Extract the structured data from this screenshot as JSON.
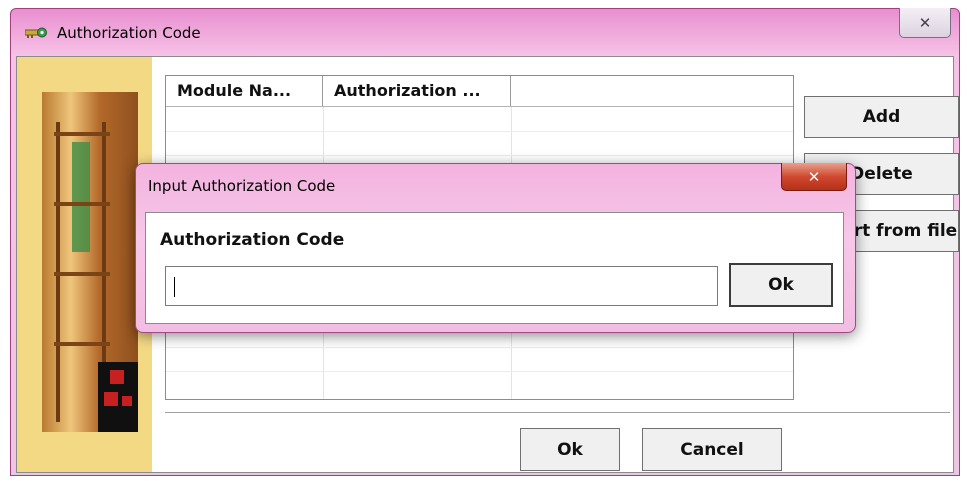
{
  "window": {
    "title": "Authorization Code",
    "close_glyph": "✕",
    "icon": "key-icon"
  },
  "table": {
    "columns": [
      "Module Na...",
      "Authorization ...",
      ""
    ],
    "rows": []
  },
  "buttons": {
    "add": "Add",
    "delete": "Delete",
    "import": "Import from file",
    "ok": "Ok",
    "cancel": "Cancel"
  },
  "dialog": {
    "title": "Input Authorization Code",
    "close_glyph": "✕",
    "label": "Authorization Code",
    "input_value": "",
    "ok": "Ok"
  },
  "colors": {
    "title_bar": "#e98fd0",
    "dialog_close": "#cf4a2f",
    "side_panel": "#f4d985"
  }
}
